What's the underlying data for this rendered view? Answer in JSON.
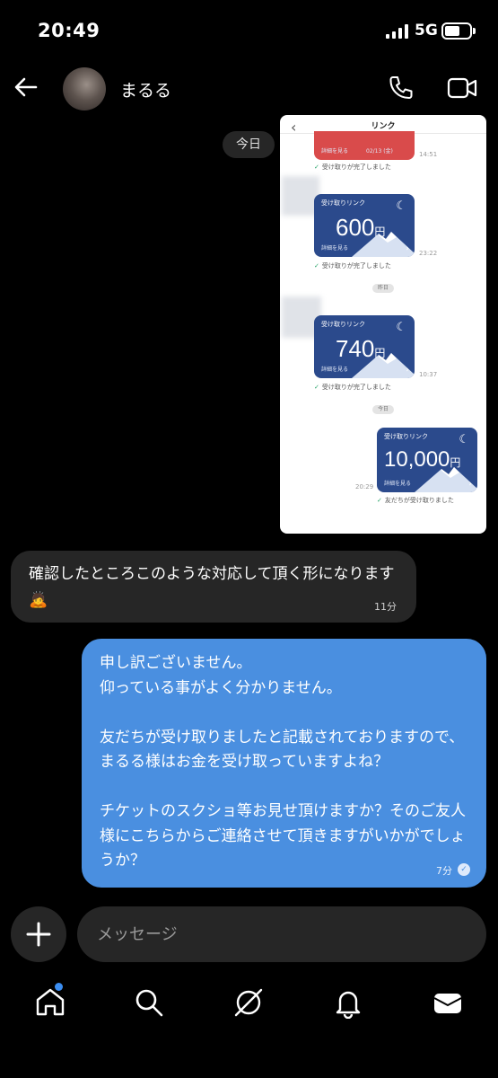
{
  "status": {
    "time": "20:49",
    "network": "5G"
  },
  "header": {
    "contact_name": "まるる"
  },
  "date_divider": "今日",
  "screenshot": {
    "title": "リンク",
    "card0": {
      "details": "詳細を見る",
      "date": "02/13 (金)",
      "time": "14:51",
      "status": "受け取りが完了しました"
    },
    "card1": {
      "label": "受け取りリンク",
      "amount": "600",
      "unit": "円",
      "details": "詳細を見る",
      "time": "23:22",
      "status": "受け取りが完了しました"
    },
    "divider1": "昨日",
    "card2": {
      "label": "受け取りリンク",
      "amount": "740",
      "unit": "円",
      "details": "詳細を見る",
      "time": "10:37",
      "status": "受け取りが完了しました"
    },
    "divider2": "今日",
    "card3": {
      "label": "受け取りリンク",
      "amount": "10,000",
      "unit": "円",
      "details": "詳細を見る",
      "time": "20:29",
      "status": "友だちが受け取りました"
    }
  },
  "messages": {
    "incoming": {
      "text": "確認したところこのような対応して頂く形になります",
      "emoji": "🙇",
      "time": "11分"
    },
    "outgoing": {
      "text": "申し訳ございません。\n仰っている事がよく分かりません。\n\n友だちが受け取りましたと記載されておりますので、まるる様はお金を受け取っていますよね？\n\nチケットのスクショ等お見せ頂けますか？そのご友人様にこちらからご連絡させて頂きますがいかがでしょうか？",
      "time": "7分"
    }
  },
  "composer": {
    "placeholder": "メッセージ"
  },
  "nav": [
    "home-icon",
    "search-icon",
    "explore-icon",
    "bell-icon",
    "inbox-icon"
  ]
}
